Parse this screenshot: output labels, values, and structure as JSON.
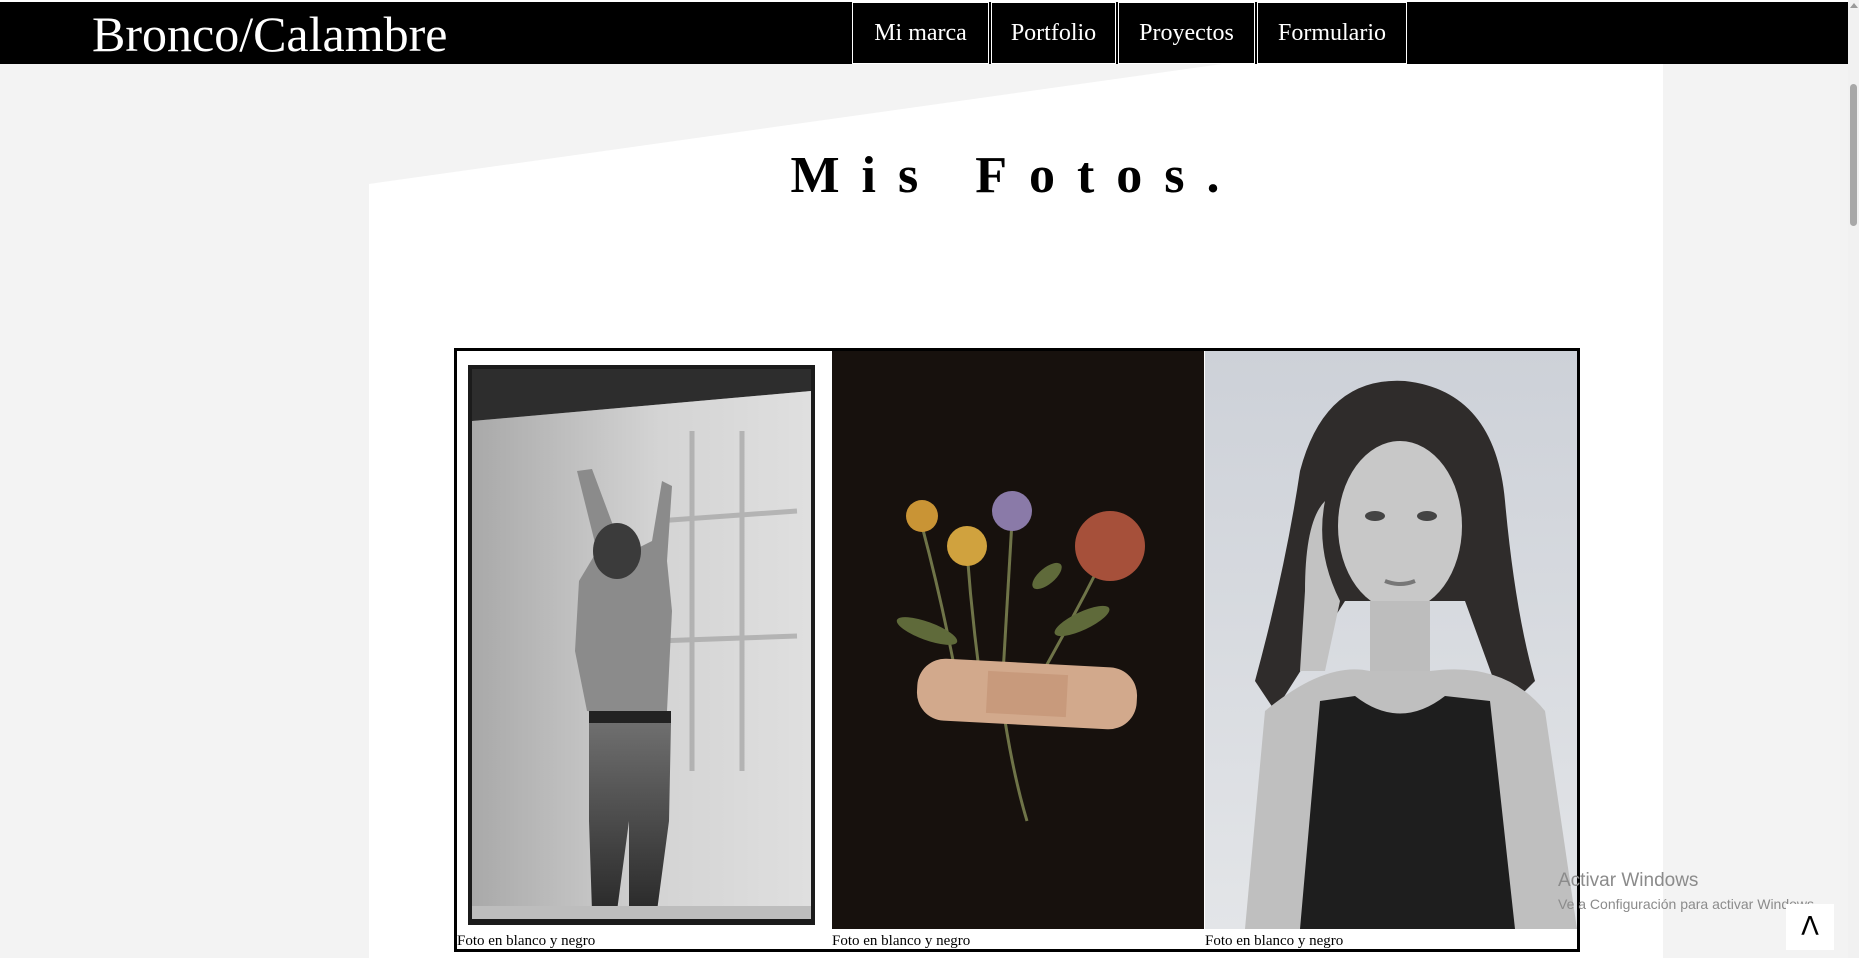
{
  "header": {
    "brand": "Bronco/Calambre",
    "nav": [
      {
        "label": "Mi marca"
      },
      {
        "label": "Portfolio"
      },
      {
        "label": "Proyectos"
      },
      {
        "label": "Formulario"
      }
    ]
  },
  "main": {
    "title": "Mis Fotos.",
    "gallery": [
      {
        "caption": "Foto en blanco y negro",
        "alt": "man stretching against wall, black and white"
      },
      {
        "caption": "Foto en blanco y negro",
        "alt": "pressed flowers with bandage on dark background"
      },
      {
        "caption": "Foto en blanco y negro",
        "alt": "portrait of woman resting head on hand"
      }
    ]
  },
  "system": {
    "watermark_title": "Activar Windows",
    "watermark_sub": "Ve a Configuración para activar Windows.",
    "back_to_top": "Λ"
  },
  "colors": {
    "header_bg": "#000000",
    "page_bg": "#f3f3f3",
    "panel_bg": "#ffffff"
  }
}
